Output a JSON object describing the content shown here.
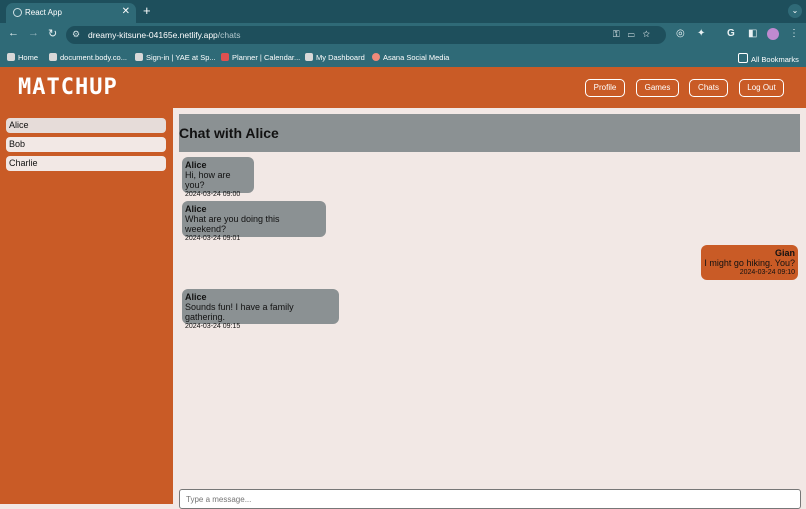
{
  "browser": {
    "tab_title": "React App",
    "tab_close": "✕",
    "new_tab": "+",
    "url_host": "dreamy-kitsune-04165e.netlify.app",
    "url_path": "/chats",
    "bookmarks": [
      {
        "label": "Home"
      },
      {
        "label": "document.body.co..."
      },
      {
        "label": "Sign-in | YAE at Sp..."
      },
      {
        "label": "Planner | Calendar..."
      },
      {
        "label": "My Dashboard"
      },
      {
        "label": "Asana Social Media"
      }
    ],
    "all_bookmarks": "All Bookmarks"
  },
  "app": {
    "logo": "MATCHUP",
    "nav": {
      "profile": "Profile",
      "games": "Games",
      "chats": "Chats",
      "logout": "Log Out"
    },
    "colors": {
      "primary": "#c95b26",
      "background": "#f2e8e5",
      "bubble_other": "#8b9193"
    }
  },
  "contacts": [
    {
      "name": "Alice",
      "active": true
    },
    {
      "name": "Bob"
    },
    {
      "name": "Charlie"
    }
  ],
  "chat": {
    "title": "Chat with Alice",
    "messages": [
      {
        "sender": "Alice",
        "text": "Hi, how are you?",
        "time": "2024-03-24 09:00",
        "mine": false
      },
      {
        "sender": "Alice",
        "text": "What are you doing this weekend?",
        "time": "2024-03-24 09:01",
        "mine": false
      },
      {
        "sender": "Gian",
        "text": "I might go hiking. You?",
        "time": "2024-03-24 09:10",
        "mine": true
      },
      {
        "sender": "Alice",
        "text": "Sounds fun! I have a family gathering.",
        "time": "2024-03-24 09:15",
        "mine": false
      }
    ],
    "composer_placeholder": "Type a message..."
  }
}
